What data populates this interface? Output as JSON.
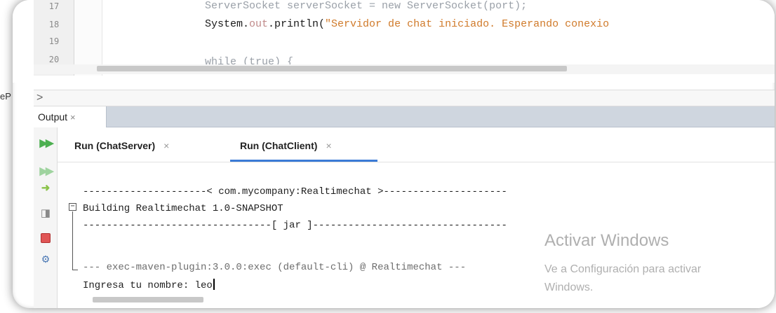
{
  "editor": {
    "lines": [
      {
        "num": "17",
        "code_faded": "ServerSocket serverSocket = new ServerSocket(port); "
      },
      {
        "num": "18",
        "code_obj": "System.",
        "code_field": "out",
        "code_method": ".println(",
        "code_string": "\"Servidor de chat iniciado. Esperando conexio"
      },
      {
        "num": "19",
        "code": ""
      },
      {
        "num": "20",
        "code_faded": "while (true) {"
      }
    ]
  },
  "navigator": {
    "chevron": ">",
    "side_label": "eP"
  },
  "output_window": {
    "tab_label": "Output",
    "tab_close": "×",
    "subtabs": [
      {
        "label": "Run (ChatServer)",
        "close": "×"
      },
      {
        "label": "Run (ChatClient)",
        "close": "×"
      }
    ],
    "active_subtab": "Run (ChatClient)"
  },
  "toolbar": {
    "icons": [
      "rerun-icon",
      "rerun-with-args-icon",
      "run-arrow-icon",
      "clear-output-icon",
      "stop-icon",
      "settings-icon"
    ]
  },
  "console": {
    "fold_toggle": "−",
    "lines": [
      "---------------------< com.mycompany:Realtimechat >---------------------",
      "Building Realtimechat 1.0-SNAPSHOT",
      "--------------------------------[ jar ]---------------------------------",
      "",
      "--- exec-maven-plugin:3.0.0:exec (default-cli) @ Realtimechat ---",
      "Ingresa tu nombre: leo"
    ]
  },
  "watermark": {
    "title": "Activar Windows",
    "subtitle_line1": "Ve a Configuración para activar",
    "subtitle_line2": "Windows."
  }
}
